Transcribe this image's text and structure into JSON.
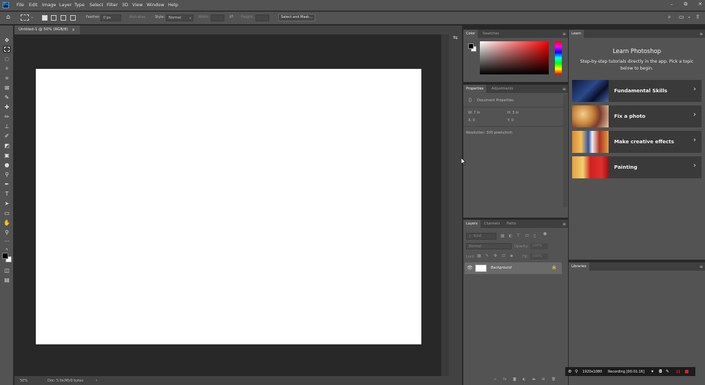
{
  "app": {
    "logo": "Ps"
  },
  "menu": [
    "File",
    "Edit",
    "Image",
    "Layer",
    "Type",
    "Select",
    "Filter",
    "3D",
    "View",
    "Window",
    "Help"
  ],
  "window_controls": {
    "minimize": "–",
    "restore": "⧉",
    "close": "✕"
  },
  "options_bar": {
    "feather_label": "Feather:",
    "feather_value": "0 px",
    "anti_alias": "Anti-alias",
    "style_label": "Style:",
    "style_value": "Normal",
    "width_label": "Width:",
    "height_label": "Height:",
    "select_mask": "Select and Mask..."
  },
  "document_tab": {
    "title": "Untitled-1 @ 50% (RGB/8)",
    "close": "×"
  },
  "status": {
    "zoom": "50%",
    "doc": "Doc: 5.0s(M)/0 bytes"
  },
  "color_panel": {
    "tabs": [
      "Color",
      "Swatches"
    ]
  },
  "properties_panel": {
    "tabs": [
      "Properties",
      "Adjustments"
    ],
    "section": "Document Properties",
    "w": "W:  7 in",
    "h": "H:  3 in",
    "x": "X:  0",
    "y": "Y:  0",
    "resolution": "Resolution: 300 pixels/inch"
  },
  "layers_panel": {
    "tabs": [
      "Layers",
      "Channels",
      "Paths"
    ],
    "kind": "Kind",
    "blend": "Normal",
    "opacity_label": "Opacity:",
    "opacity_value": "100%",
    "lock_label": "Lock:",
    "fill_label": "Fill:",
    "fill_value": "100%",
    "layer_name": "Background"
  },
  "learn_panel": {
    "tab": "Learn",
    "title": "Learn Photoshop",
    "subtitle": "Step-by-step tutorials directly in the app. Pick a topic below to begin.",
    "items": [
      "Fundamental Skills",
      "Fix a photo",
      "Make creative effects",
      "Painting"
    ]
  },
  "libraries_panel": {
    "tab": "Libraries"
  },
  "recording": {
    "resolution": "1920x1080",
    "label": "Recording [00:01:16]"
  },
  "colors": {
    "accent": "#31a8ff",
    "panel": "#535353",
    "canvas_bg": "#282828",
    "record_red": "#e02020"
  }
}
